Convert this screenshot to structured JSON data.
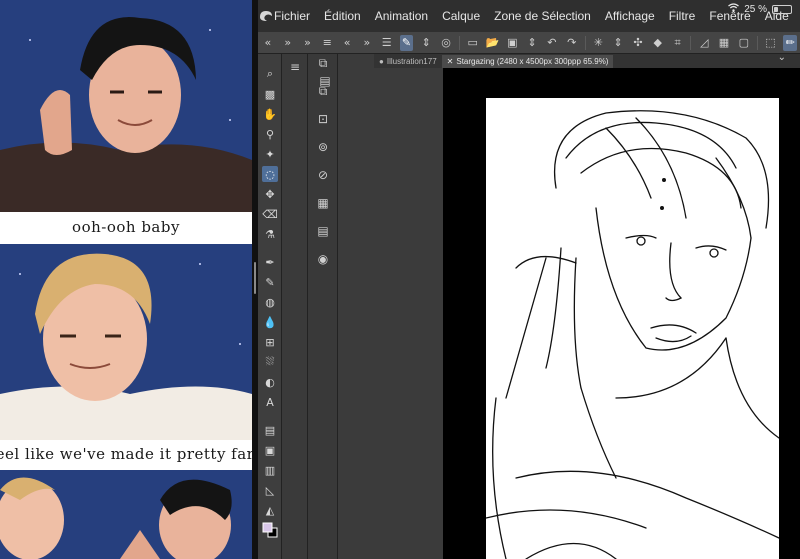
{
  "comic": {
    "caption_1": "ooh-ooh baby",
    "caption_2": "eel like we've made it pretty far"
  },
  "menubar": {
    "items": [
      "Fichier",
      "Édition",
      "Animation",
      "Calque",
      "Zone de Sélection",
      "Affichage",
      "Filtre",
      "Fenêtre",
      "Aide"
    ]
  },
  "status": {
    "battery_percent": "25 %",
    "battery_level": 0.25
  },
  "tabs": [
    {
      "label": "Illustration177",
      "active": false
    },
    {
      "label": "Stargazing (2480 x 4500px 300ppp 65.9%)",
      "active": true
    }
  ],
  "icons": {
    "app_logo": "clip-studio-logo-icon",
    "wifi": "wifi-icon",
    "battery": "battery-icon"
  },
  "colors": {
    "night_sky": "#263f7e",
    "accent": "#4f6f99",
    "foreground_color": "#d9c7ea",
    "background_color": "#000000"
  }
}
